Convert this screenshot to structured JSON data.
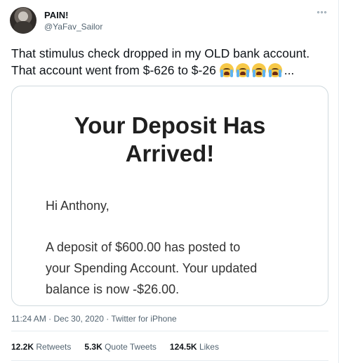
{
  "author": {
    "name": "PAIN!",
    "handle": "@YaFav_Sailor"
  },
  "tweet": {
    "line1": "That stimulus check dropped in my OLD bank account.",
    "line2": "That account went from $-626 to $-26",
    "emoji": [
      "loudly-crying-face",
      "loudly-crying-face",
      "loudly-crying-face",
      "loudly-crying-face"
    ],
    "ellipsis": "..."
  },
  "card": {
    "title_line1": "Your Deposit Has",
    "title_line2": "Arrived!",
    "greeting": "Hi Anthony,",
    "body_line1": "A deposit of $600.00 has posted to",
    "body_line2": "your Spending Account. Your updated",
    "body_line3": "balance is now -$26.00."
  },
  "meta": {
    "time": "11:24 AM",
    "separator": " · ",
    "date": "Dec 30, 2020",
    "source": "Twitter for iPhone"
  },
  "stats": {
    "retweets_count": "12.2K",
    "retweets_label": " Retweets",
    "quotes_count": "5.3K",
    "quotes_label": " Quote Tweets",
    "likes_count": "124.5K",
    "likes_label": " Likes"
  },
  "colors": {
    "text": "#0f1419",
    "muted": "#536471",
    "border": "#cfd9de",
    "emoji": "#f7c948"
  }
}
